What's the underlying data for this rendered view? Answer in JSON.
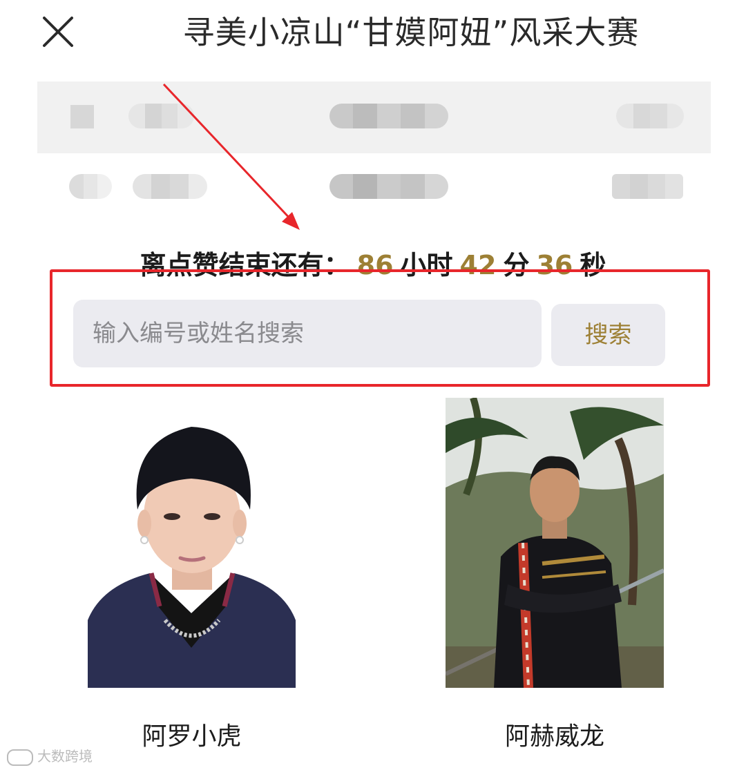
{
  "header": {
    "title": "寻美小凉山“甘嫫阿妞”风采大赛",
    "close_icon": "close-icon"
  },
  "countdown": {
    "label": "离点赞结束还有：",
    "hours": "86",
    "hours_unit": "小时",
    "minutes": "42",
    "minutes_unit": "分",
    "seconds": "36",
    "seconds_unit": "秒"
  },
  "search": {
    "placeholder": "输入编号或姓名搜索",
    "value": "",
    "button_label": "搜索"
  },
  "contestants": [
    {
      "name": "阿罗小虎"
    },
    {
      "name": "阿赫威龙"
    }
  ],
  "watermark": "大数跨境",
  "colors": {
    "accent": "#9d8035",
    "annotation": "#e8262b",
    "input_bg": "#ebebf0",
    "panel_bg": "#f1f1f1"
  }
}
